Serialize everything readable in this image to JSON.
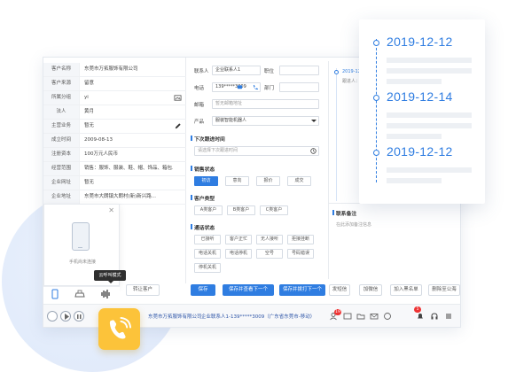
{
  "customer_info": [
    {
      "label": "客户名称",
      "value": "东莞市万拓服饰有限公司"
    },
    {
      "label": "客户来源",
      "value": "留意"
    },
    {
      "label": "所属分组",
      "value": "yi"
    },
    {
      "label": "法人",
      "value": "黄月"
    },
    {
      "label": "主营业务",
      "value": "暂无"
    },
    {
      "label": "成立时间",
      "value": "2009-08-13"
    },
    {
      "label": "注册资本",
      "value": "100万元人民币"
    },
    {
      "label": "经营范围",
      "value": "销售：服饰、服装、鞋、帽、饰品、箱包..."
    },
    {
      "label": "企业网址",
      "value": "暂无"
    },
    {
      "label": "企业地址",
      "value": "东莞市大朗镇大朗村(新)新兴路..."
    }
  ],
  "phone_popup": {
    "text": "手机尚未连接",
    "tooltip": "云呼叫模式"
  },
  "form": {
    "contact_label": "联系人",
    "contact_value": "企业联系人1",
    "position_label": "职位",
    "phone_label": "电话",
    "phone_value": "139*****3009",
    "dept_label": "部门",
    "email_label": "邮箱",
    "email_placeholder": "暂无邮箱地址",
    "product_label": "产品",
    "product_value": "服装智能机器人",
    "next_visit_title": "下次跟进时间",
    "next_visit_placeholder": "请选择下次跟进时间",
    "sales_status_title": "销售状态",
    "sales_status": [
      "初访",
      "意向",
      "报价",
      "成交"
    ],
    "customer_type_title": "客户类型",
    "customer_type": [
      "A类客户",
      "B类客户",
      "C类客户"
    ],
    "call_status_title": "通话状态",
    "call_status": [
      "已接听",
      "客户正忙",
      "无人接听",
      "拒接挂断",
      "电话关机",
      "电话停机",
      "空号",
      "号码错误",
      "停机关机"
    ]
  },
  "record_panel": {
    "entry_date": "2019-12-12 ...",
    "entry_text": "跟进人：...",
    "contact_note_title": "联系备注",
    "contact_note_placeholder": "在此添加备注信息"
  },
  "buttons": {
    "transfer": "转让客户",
    "save": "保存",
    "save_next": "保存并查看下一个",
    "save_call_next": "保存并拨打下一个",
    "send_sms": "发短信",
    "add_wechat": "加微信",
    "add_blacklist": "加入黑名单",
    "delete": "删除至公海"
  },
  "status_bar": {
    "company": "东莞市万拓服饰有限公司",
    "contact": "企业联系人1-139*****3009（广东省东莞市-移动）",
    "badge_left": "19",
    "badge_right": "5"
  },
  "timeline": {
    "dates": [
      "2019-12-12",
      "2019-12-14",
      "2019-12-12"
    ]
  },
  "colors": {
    "accent": "#2f7de1",
    "call_badge": "#fcc33a"
  },
  "icons": [
    "image-icon",
    "edit-icon",
    "phone-icon",
    "message-icon",
    "clock-icon",
    "chevron-down-icon",
    "close-icon",
    "play-icon",
    "pause-icon",
    "call-icon"
  ]
}
